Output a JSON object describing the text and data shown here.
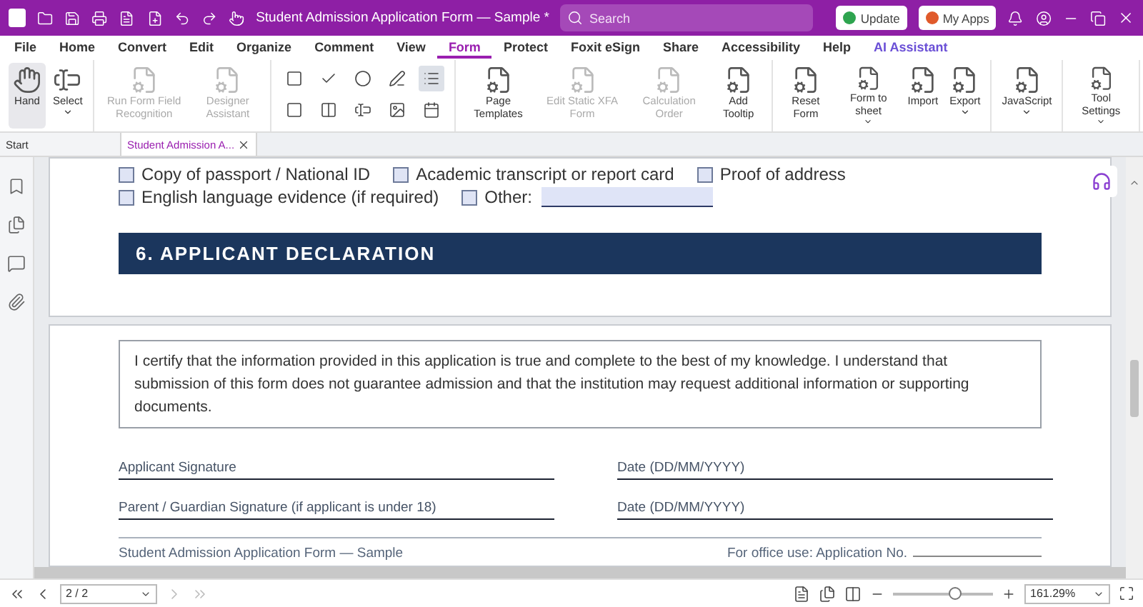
{
  "title_bar": {
    "title": "Student Admission Application Form — Sample *",
    "search_placeholder": "Search",
    "buttons": [
      "Update",
      "My Apps"
    ]
  },
  "menu": [
    {
      "label": "File",
      "selected": false
    },
    {
      "label": "Home",
      "selected": false
    },
    {
      "label": "Convert",
      "selected": false
    },
    {
      "label": "Edit",
      "selected": false
    },
    {
      "label": "Organize",
      "selected": false
    },
    {
      "label": "Comment",
      "selected": false
    },
    {
      "label": "View",
      "selected": false
    },
    {
      "label": "Form",
      "selected": true
    },
    {
      "label": "Protect",
      "selected": false
    },
    {
      "label": "Foxit eSign",
      "selected": false
    },
    {
      "label": "Share",
      "selected": false
    },
    {
      "label": "Accessibility",
      "selected": false
    },
    {
      "label": "Help",
      "selected": false
    },
    {
      "label": "AI Assistant",
      "selected": false,
      "kind": "ai"
    }
  ],
  "ribbon": [
    {
      "kind": "buttons",
      "items": [
        {
          "label": "Hand",
          "disabled": false,
          "dropdown": false,
          "selected": true
        },
        {
          "label": "Select",
          "disabled": false,
          "dropdown": true,
          "selected": false
        }
      ]
    },
    {
      "kind": "buttons",
      "items": [
        {
          "label": "Run Form Field Recognition",
          "disabled": true,
          "dropdown": false,
          "selected": false
        },
        {
          "label": "Designer Assistant",
          "disabled": true,
          "dropdown": false,
          "selected": false
        }
      ]
    },
    {
      "kind": "grid",
      "cells": [
        {
          "hovered": false
        },
        {
          "hovered": false
        },
        {
          "hovered": false
        },
        {
          "hovered": false
        },
        {
          "hovered": true
        },
        {
          "hovered": false
        },
        {
          "hovered": false
        },
        {
          "hovered": false
        },
        {
          "hovered": false
        },
        {
          "hovered": false
        }
      ]
    },
    {
      "kind": "buttons",
      "items": [
        {
          "label": "Page Templates",
          "disabled": false,
          "dropdown": false,
          "selected": false
        },
        {
          "label": "Edit Static XFA Form",
          "disabled": true,
          "dropdown": false,
          "selected": false
        },
        {
          "label": "Calculation Order",
          "disabled": true,
          "dropdown": false,
          "selected": false
        },
        {
          "label": "Add Tooltip",
          "disabled": false,
          "dropdown": false,
          "selected": false
        }
      ]
    },
    {
      "kind": "buttons",
      "items": [
        {
          "label": "Reset Form",
          "disabled": false,
          "dropdown": false,
          "selected": false
        },
        {
          "label": "Form to sheet",
          "disabled": false,
          "dropdown": true,
          "selected": false
        },
        {
          "label": "Import",
          "disabled": false,
          "dropdown": false,
          "selected": false
        },
        {
          "label": "Export",
          "disabled": false,
          "dropdown": true,
          "selected": false
        }
      ]
    },
    {
      "kind": "buttons",
      "items": [
        {
          "label": "JavaScript",
          "disabled": false,
          "dropdown": true,
          "selected": false
        }
      ]
    },
    {
      "kind": "buttons",
      "items": [
        {
          "label": "Tool Settings",
          "disabled": false,
          "dropdown": true,
          "selected": false
        }
      ]
    }
  ],
  "doc_tabs": [
    {
      "label": "Start",
      "selected": false
    },
    {
      "label": "Student Admission A...",
      "selected": true
    }
  ],
  "document": {
    "checklist": [
      {
        "label": "Copy of passport / National ID",
        "checked": false
      },
      {
        "label": "Academic transcript or report card",
        "checked": false
      },
      {
        "label": "Proof of address",
        "checked": false
      },
      {
        "label": "English language evidence (if required)",
        "checked": false
      }
    ],
    "other": {
      "label": "Other:",
      "checked": false
    },
    "section_heading": "6. APPLICANT DECLARATION",
    "declaration": "I certify that the information provided in this application is true and complete to the best of my knowledge. I understand that submission of this form does not guarantee admission and that the institution may request additional information or supporting documents.",
    "signature_lines": [
      [
        "Applicant Signature",
        "Date (DD/MM/YYYY)"
      ],
      [
        "Parent / Guardian Signature (if applicant is under 18)",
        "Date (DD/MM/YYYY)"
      ]
    ],
    "footer": {
      "left": "Student Admission Application Form — Sample",
      "right": "For office use: Application No."
    }
  },
  "status_bar": {
    "page": "2 / 2",
    "zoom": "161.29%",
    "zoom_level": {
      "level": 0.62
    }
  }
}
